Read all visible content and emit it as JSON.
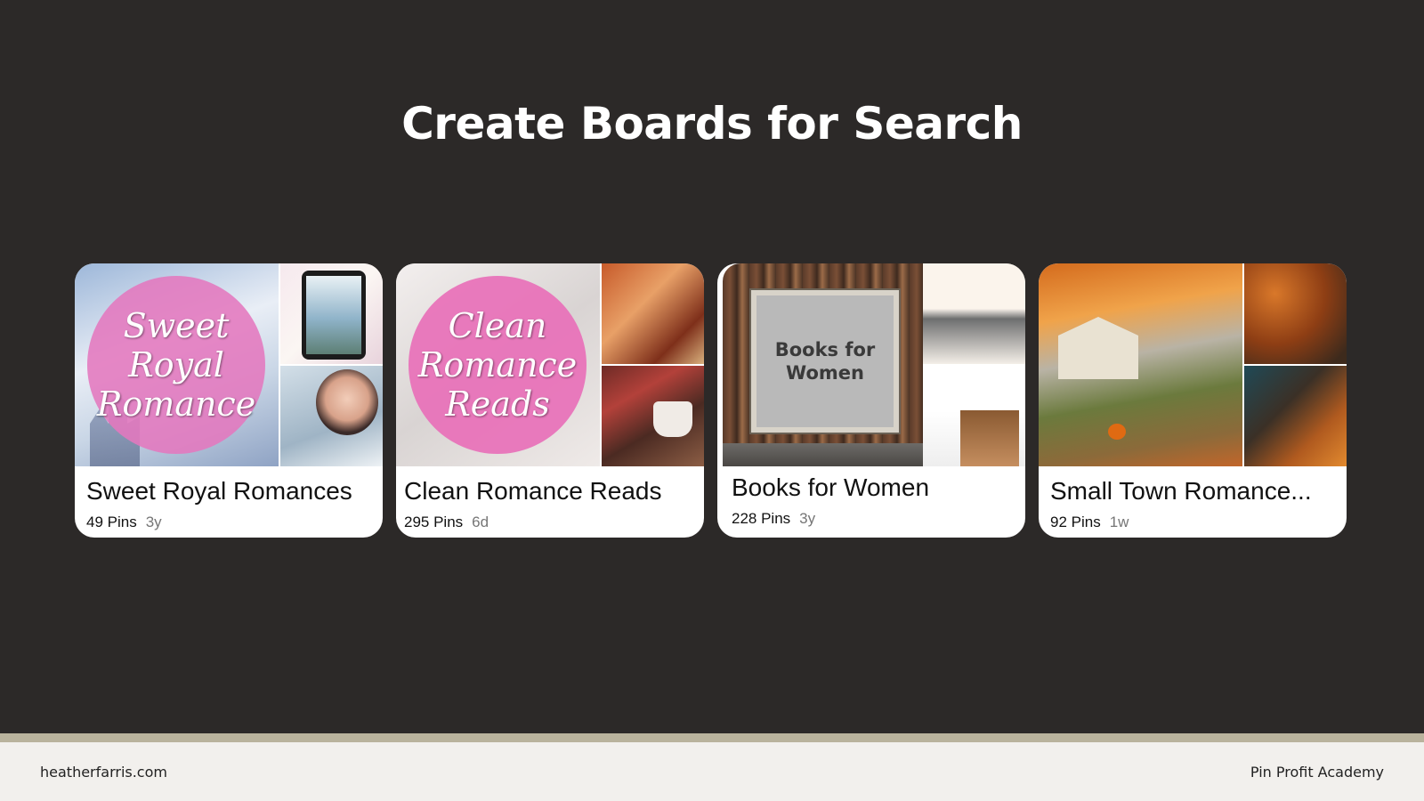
{
  "slide": {
    "title": "Create Boards for Search"
  },
  "boards": [
    {
      "title": "Sweet Royal Romances",
      "pins": "49 Pins",
      "age": "3y",
      "cover_text": [
        "Sweet",
        "Royal",
        "Romance"
      ]
    },
    {
      "title": "Clean Romance Reads",
      "pins": "295 Pins",
      "age": "6d",
      "cover_text": [
        "Clean",
        "Romance",
        "Reads"
      ]
    },
    {
      "title": "Books for Women",
      "pins": "228 Pins",
      "age": "3y",
      "cover_text": [
        "Books for",
        "Women"
      ]
    },
    {
      "title": "Small Town Romance...",
      "pins": "92 Pins",
      "age": "1w"
    }
  ],
  "footer": {
    "left": "heatherfarris.com",
    "right": "Pin Profit Academy"
  },
  "colors": {
    "background": "#2c2928",
    "card": "#ffffff",
    "badge_pink": "#e478be",
    "footer_bg": "#f2f0ed",
    "footer_stripe": "#b9b39d"
  }
}
